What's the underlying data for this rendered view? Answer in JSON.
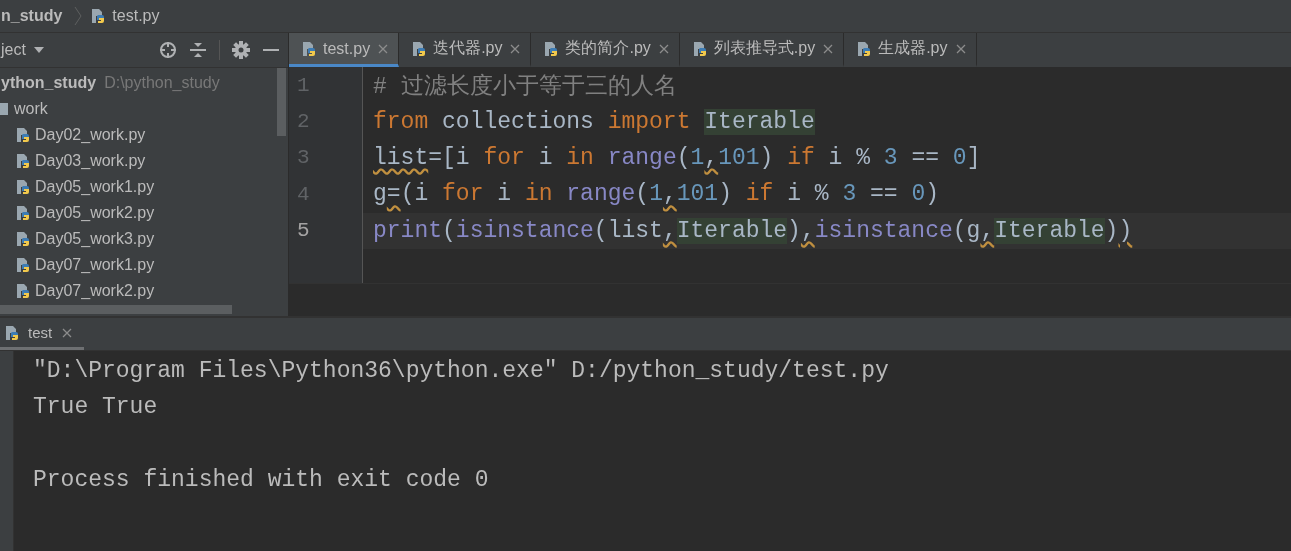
{
  "breadcrumb": [
    {
      "label": "n_study",
      "kind": "folder"
    },
    {
      "label": "test.py",
      "kind": "file"
    }
  ],
  "project_panel": {
    "title": "ject",
    "root": {
      "name": "ython_study",
      "path": "D:\\python_study",
      "children": [
        {
          "name": "work",
          "kind": "folder",
          "children": [
            {
              "name": "Day02_work.py",
              "kind": "file"
            },
            {
              "name": "Day03_work.py",
              "kind": "file"
            },
            {
              "name": "Day05_work1.py",
              "kind": "file"
            },
            {
              "name": "Day05_work2.py",
              "kind": "file"
            },
            {
              "name": "Day05_work3.py",
              "kind": "file"
            },
            {
              "name": "Day07_work1.py",
              "kind": "file"
            },
            {
              "name": "Day07_work2.py",
              "kind": "file"
            }
          ]
        }
      ]
    }
  },
  "tabs": [
    {
      "label": "test.py",
      "selected": true
    },
    {
      "label": "迭代器.py",
      "selected": false
    },
    {
      "label": "类的简介.py",
      "selected": false
    },
    {
      "label": "列表推导式.py",
      "selected": false
    },
    {
      "label": "生成器.py",
      "selected": false
    }
  ],
  "code_lines": [
    {
      "number": "1",
      "current": false,
      "tokens": [
        {
          "text": "# 过滤长度小于等于三的人名",
          "kind": "comment"
        }
      ]
    },
    {
      "number": "2",
      "current": false,
      "tokens": [
        {
          "text": "from",
          "kind": "keyword"
        },
        {
          "text": " collections ",
          "kind": "plain"
        },
        {
          "text": "import ",
          "kind": "keyword"
        },
        {
          "text": "Iterable",
          "kind": "plain",
          "highlight": true
        }
      ]
    },
    {
      "number": "3",
      "current": false,
      "tokens": [
        {
          "text": "list",
          "kind": "plain",
          "squiggle": true
        },
        {
          "text": "=[i ",
          "kind": "plain"
        },
        {
          "text": "for",
          "kind": "keyword"
        },
        {
          "text": " i ",
          "kind": "plain"
        },
        {
          "text": "in ",
          "kind": "keyword"
        },
        {
          "text": "range",
          "kind": "builtin"
        },
        {
          "text": "(",
          "kind": "plain"
        },
        {
          "text": "1",
          "kind": "number"
        },
        {
          "text": ",",
          "kind": "plain",
          "squiggle": true
        },
        {
          "text": "101",
          "kind": "number"
        },
        {
          "text": ") ",
          "kind": "plain"
        },
        {
          "text": "if",
          "kind": "keyword"
        },
        {
          "text": " i % ",
          "kind": "plain"
        },
        {
          "text": "3",
          "kind": "number"
        },
        {
          "text": " == ",
          "kind": "plain"
        },
        {
          "text": "0",
          "kind": "number"
        },
        {
          "text": "]",
          "kind": "plain"
        }
      ]
    },
    {
      "number": "4",
      "current": false,
      "tokens": [
        {
          "text": "g",
          "kind": "plain"
        },
        {
          "text": "=",
          "kind": "plain",
          "squiggle": true
        },
        {
          "text": "(i ",
          "kind": "plain"
        },
        {
          "text": "for",
          "kind": "keyword"
        },
        {
          "text": " i ",
          "kind": "plain"
        },
        {
          "text": "in ",
          "kind": "keyword"
        },
        {
          "text": "range",
          "kind": "builtin"
        },
        {
          "text": "(",
          "kind": "plain"
        },
        {
          "text": "1",
          "kind": "number"
        },
        {
          "text": ",",
          "kind": "plain",
          "squiggle": true
        },
        {
          "text": "101",
          "kind": "number"
        },
        {
          "text": ") ",
          "kind": "plain"
        },
        {
          "text": "if",
          "kind": "keyword"
        },
        {
          "text": " i % ",
          "kind": "plain"
        },
        {
          "text": "3",
          "kind": "number"
        },
        {
          "text": " == ",
          "kind": "plain"
        },
        {
          "text": "0",
          "kind": "number"
        },
        {
          "text": ")",
          "kind": "plain"
        }
      ]
    },
    {
      "number": "5",
      "current": true,
      "tokens": [
        {
          "text": "print",
          "kind": "builtin"
        },
        {
          "text": "(",
          "kind": "plain"
        },
        {
          "text": "isinstance",
          "kind": "builtin"
        },
        {
          "text": "(list",
          "kind": "plain"
        },
        {
          "text": ",",
          "kind": "plain",
          "squiggle": true
        },
        {
          "text": "Iterable",
          "kind": "plain",
          "highlight": true
        },
        {
          "text": ")",
          "kind": "plain"
        },
        {
          "text": ",",
          "kind": "plain",
          "squiggle": true
        },
        {
          "text": "isinstance",
          "kind": "builtin"
        },
        {
          "text": "(g",
          "kind": "plain"
        },
        {
          "text": ",",
          "kind": "plain",
          "squiggle": true
        },
        {
          "text": "Iterable",
          "kind": "plain",
          "highlight": true
        },
        {
          "text": ")",
          "kind": "plain"
        },
        {
          "text": ")",
          "kind": "plain",
          "squiggle": true
        }
      ]
    }
  ],
  "run_panel": {
    "tab": {
      "label": "test",
      "selected": true
    },
    "output": [
      {
        "text": "\"D:\\Program Files\\Python36\\python.exe\" D:/python_study/test.py",
        "spaced": false
      },
      {
        "text": "True True",
        "spaced": false
      },
      {
        "text": "Process finished with exit code 0",
        "spaced": true
      }
    ]
  }
}
